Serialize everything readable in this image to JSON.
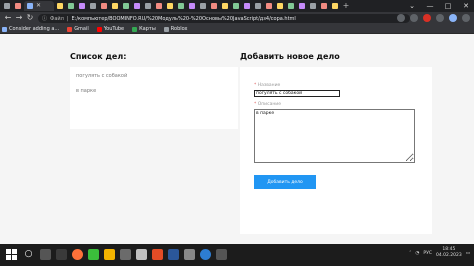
{
  "browser": {
    "address_scheme": "Файл",
    "url": "E:/компьютер/BOOMINFO.RU/%20Модуль%20-%20Основы%20JavaScript/дз4/сора.html",
    "bookmarks": [
      {
        "label": "Consider adding a...",
        "color": "#8ab4f8"
      },
      {
        "label": "Gmail",
        "color": "#ea4335"
      },
      {
        "label": "YouTube",
        "color": "#ff0000"
      },
      {
        "label": "Карты",
        "color": "#34a853"
      },
      {
        "label": "Roblox",
        "color": "#9aa0a6"
      }
    ]
  },
  "page": {
    "list_heading": "Список дел:",
    "list_items": [
      "погулять с собакой",
      "в парке"
    ],
    "form_heading": "Добавить новое дело",
    "name_label": "Название",
    "name_value": "погулять с собакой",
    "description_label": "Описание",
    "description_value": "в парке",
    "submit_label": "Добавить дело"
  },
  "taskbar": {
    "language": "РУС",
    "time": "18:45",
    "date": "04.02.2023"
  },
  "colors": {
    "accent": "#2196f3",
    "required": "#e06666"
  }
}
